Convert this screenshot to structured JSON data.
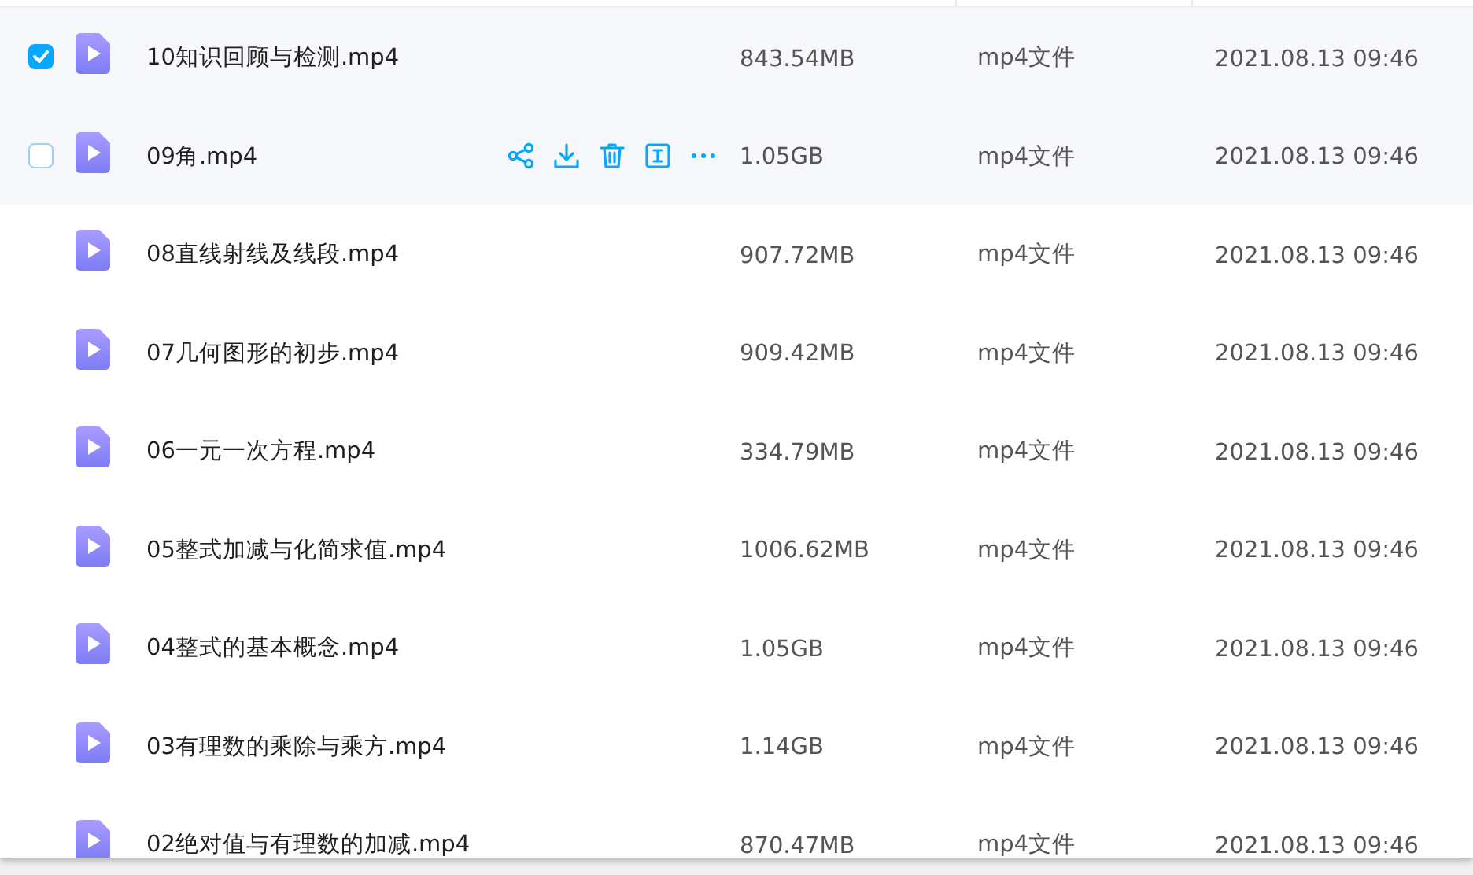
{
  "files": [
    {
      "name": "10知识回顾与检测.mp4",
      "size": "843.54MB",
      "type": "mp4文件",
      "date": "2021.08.13 09:46",
      "selected": true,
      "hovered": false
    },
    {
      "name": "09角.mp4",
      "size": "1.05GB",
      "type": "mp4文件",
      "date": "2021.08.13 09:46",
      "selected": false,
      "hovered": true
    },
    {
      "name": "08直线射线及线段.mp4",
      "size": "907.72MB",
      "type": "mp4文件",
      "date": "2021.08.13 09:46",
      "selected": false,
      "hovered": false
    },
    {
      "name": "07几何图形的初步.mp4",
      "size": "909.42MB",
      "type": "mp4文件",
      "date": "2021.08.13 09:46",
      "selected": false,
      "hovered": false
    },
    {
      "name": "06一元一次方程.mp4",
      "size": "334.79MB",
      "type": "mp4文件",
      "date": "2021.08.13 09:46",
      "selected": false,
      "hovered": false
    },
    {
      "name": "05整式加减与化简求值.mp4",
      "size": "1006.62MB",
      "type": "mp4文件",
      "date": "2021.08.13 09:46",
      "selected": false,
      "hovered": false
    },
    {
      "name": "04整式的基本概念.mp4",
      "size": "1.05GB",
      "type": "mp4文件",
      "date": "2021.08.13 09:46",
      "selected": false,
      "hovered": false
    },
    {
      "name": "03有理数的乘除与乘方.mp4",
      "size": "1.14GB",
      "type": "mp4文件",
      "date": "2021.08.13 09:46",
      "selected": false,
      "hovered": false
    },
    {
      "name": "02绝对值与有理数的加减.mp4",
      "size": "870.47MB",
      "type": "mp4文件",
      "date": "2021.08.13 09:46",
      "selected": false,
      "hovered": false
    }
  ]
}
